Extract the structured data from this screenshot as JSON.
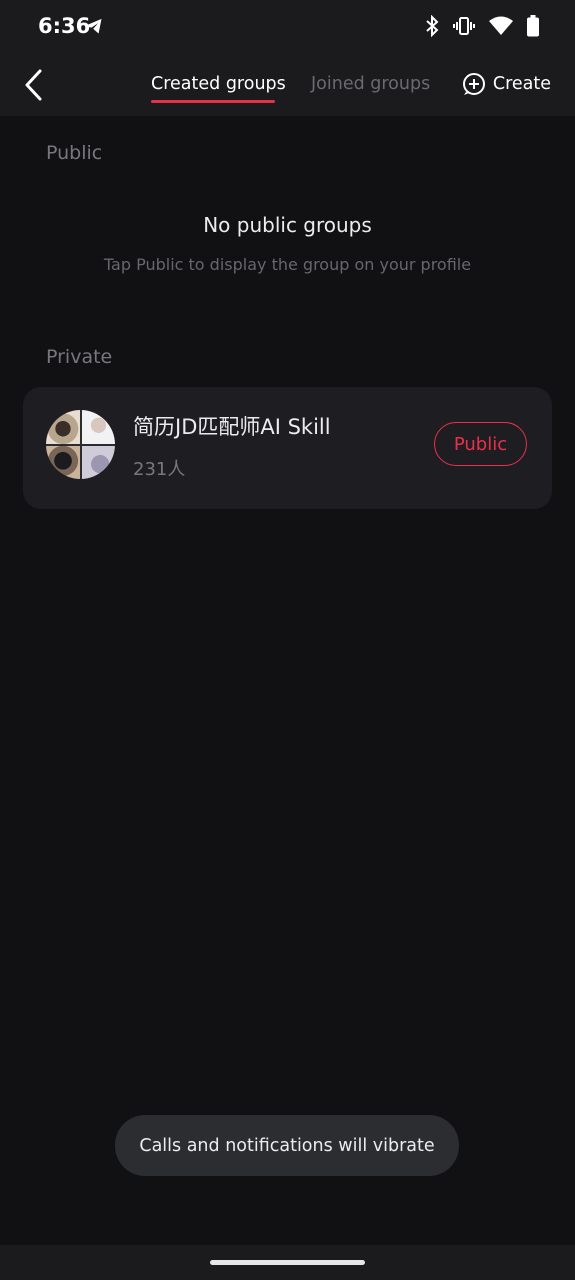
{
  "status_bar": {
    "time": "6:36",
    "icons": [
      "telegram-icon",
      "bluetooth-icon",
      "vibrate-icon",
      "wifi-icon",
      "battery-icon"
    ]
  },
  "header": {
    "tabs": [
      {
        "label": "Created groups",
        "active": true
      },
      {
        "label": "Joined groups",
        "active": false
      }
    ],
    "create_label": "Create"
  },
  "sections": {
    "public": {
      "label": "Public",
      "empty_title": "No public groups",
      "empty_subtitle": "Tap Public to display the group on your profile"
    },
    "private": {
      "label": "Private",
      "groups": [
        {
          "name": "简历JD匹配师AI Skill",
          "member_count": "231人",
          "action_label": "Public"
        }
      ]
    }
  },
  "toast": {
    "message": "Calls and notifications will vibrate"
  },
  "colors": {
    "accent": "#e8304b",
    "background": "#111113",
    "card": "#1e1e22"
  }
}
